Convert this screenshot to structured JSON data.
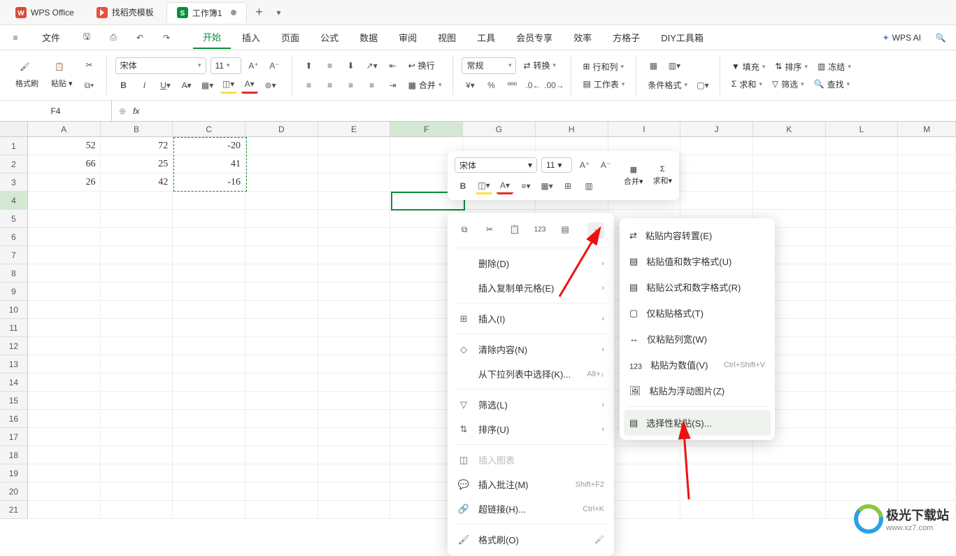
{
  "title_bar": {
    "app_name": "WPS Office",
    "template_tab": "找稻壳模板",
    "doc_tab": "工作簿1"
  },
  "menu": {
    "hamburger": "≡",
    "file": "文件",
    "items": [
      "开始",
      "插入",
      "页面",
      "公式",
      "数据",
      "审阅",
      "视图",
      "工具",
      "会员专享",
      "效率",
      "方格子",
      "DIY工具箱"
    ],
    "ai": "WPS AI"
  },
  "ribbon": {
    "format_painter": "格式刷",
    "paste": "粘贴",
    "font_name": "宋体",
    "font_size": "11",
    "wrap": "换行",
    "merge": "合并",
    "number_format": "常规",
    "convert": "转换",
    "row_col": "行和列",
    "worksheet": "工作表",
    "cond_format": "条件格式",
    "fill": "填充",
    "sum": "求和",
    "sort": "排序",
    "filter": "筛选",
    "freeze": "冻结",
    "find": "查找"
  },
  "formula_bar": {
    "cell_ref": "F4",
    "fx": "fx"
  },
  "columns": [
    "A",
    "B",
    "C",
    "D",
    "E",
    "F",
    "G",
    "H",
    "I",
    "J",
    "K",
    "L",
    "M"
  ],
  "rows": [
    1,
    2,
    3,
    4,
    5,
    6,
    7,
    8,
    9,
    10,
    11,
    12,
    13,
    14,
    15,
    16,
    17,
    18,
    19,
    20,
    21
  ],
  "cells": {
    "A1": "52",
    "B1": "72",
    "C1": "-20",
    "A2": "66",
    "B2": "25",
    "C2": "41",
    "A3": "26",
    "B3": "42",
    "C3": "-16"
  },
  "mini_toolbar": {
    "font": "宋体",
    "size": "11",
    "merge": "合并",
    "sum": "求和"
  },
  "context_menu": {
    "delete": "删除(D)",
    "insert_copy": "插入复制单元格(E)",
    "insert": "插入(I)",
    "clear": "清除内容(N)",
    "dropdown_select": "从下拉列表中选择(K)...",
    "dropdown_shortcut": "Alt+↓",
    "filter": "筛选(L)",
    "sort": "排序(U)",
    "insert_chart": "插入图表",
    "insert_comment": "插入批注(M)",
    "comment_shortcut": "Shift+F2",
    "hyperlink": "超链接(H)...",
    "hyperlink_shortcut": "Ctrl+K",
    "format_brush": "格式刷(O)"
  },
  "submenu": {
    "transpose": "粘贴内容转置(E)",
    "values_number": "粘贴值和数字格式(U)",
    "formula_number": "粘贴公式和数字格式(R)",
    "format_only": "仅粘贴格式(T)",
    "col_width": "仅粘贴列宽(W)",
    "as_values": "粘贴为数值(V)",
    "as_values_shortcut": "Ctrl+Shift+V",
    "as_picture": "粘贴为浮动图片(Z)",
    "paste_special": "选择性粘贴(S)..."
  },
  "watermark": {
    "text": "极光下载站",
    "url": "www.xz7.com"
  }
}
